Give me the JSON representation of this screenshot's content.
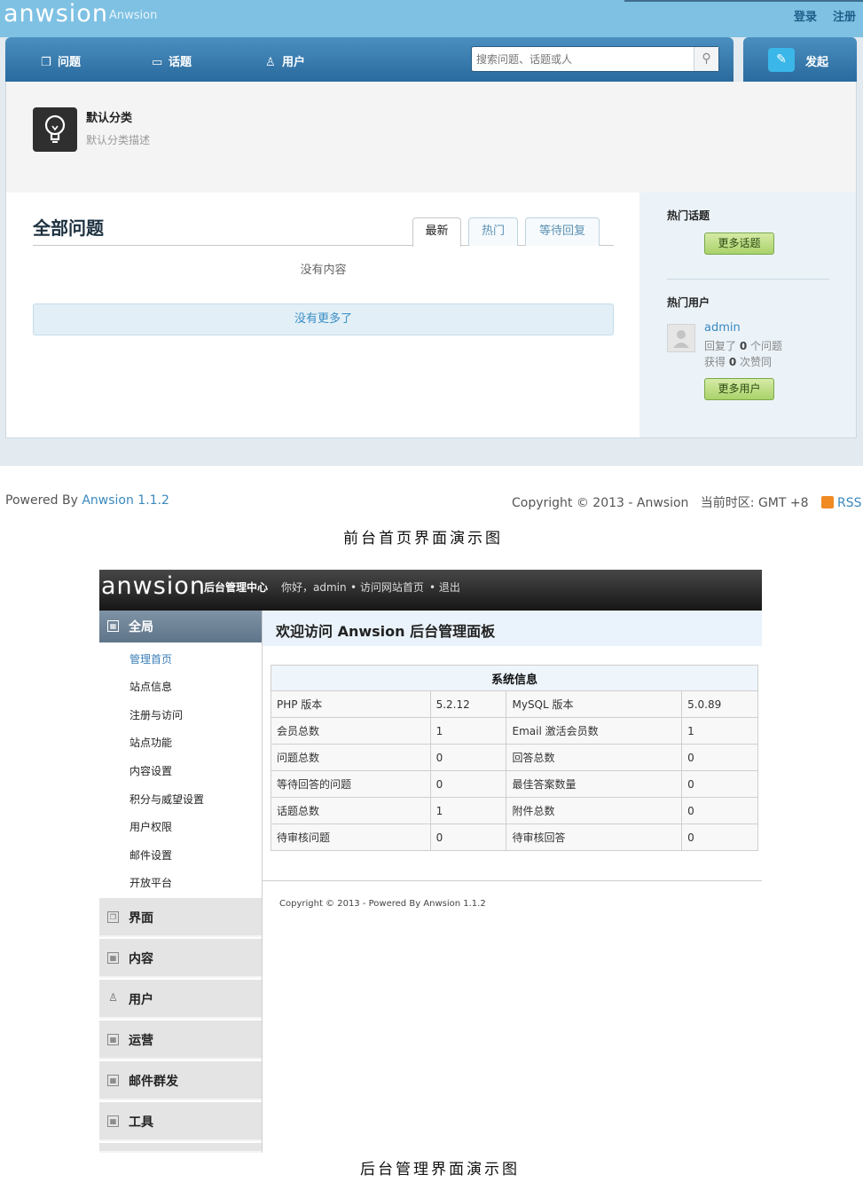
{
  "front": {
    "logo": "anwsion",
    "site_name": "Anwsion",
    "top_links": {
      "login": "登录",
      "register": "注册"
    },
    "nav": [
      {
        "label": "问题",
        "icon": "questions-icon"
      },
      {
        "label": "话题",
        "icon": "topics-icon"
      },
      {
        "label": "用户",
        "icon": "users-icon"
      }
    ],
    "search": {
      "placeholder": "搜索问题、话题或人"
    },
    "publish_label": "发起",
    "category": {
      "name": "默认分类",
      "description": "默认分类描述"
    },
    "main": {
      "title": "全部问题",
      "tabs": [
        "最新",
        "热门",
        "等待回复"
      ],
      "active_tab": "最新",
      "empty_text": "没有内容",
      "no_more": "没有更多了"
    },
    "sidebar": {
      "hot_topics_title": "热门话题",
      "more_topics": "更多话题",
      "hot_users_title": "热门用户",
      "user": {
        "name": "admin",
        "answered_prefix": "回复了",
        "answered_count": "0",
        "answered_suffix": "个问题",
        "agree_prefix": "获得",
        "agree_count": "0",
        "agree_suffix": "次赞同"
      },
      "more_users": "更多用户"
    },
    "footer": {
      "powered_prefix": "Powered By",
      "powered_link": "Anwsion 1.1.2",
      "copyright": "Copyright © 2013 - Anwsion",
      "timezone": "当前时区: GMT +8",
      "rss": "RSS Feed"
    }
  },
  "captions": {
    "front": "前台首页界面演示图",
    "admin": "后台管理界面演示图"
  },
  "admin": {
    "logo": "anwsion",
    "center_title": "后台管理中心",
    "greeting": "你好，admin",
    "visit_site": "• 访问网站首页",
    "logout": "• 退出",
    "menu": {
      "active_group": "全局",
      "sub_items": [
        "管理首页",
        "站点信息",
        "注册与访问",
        "站点功能",
        "内容设置",
        "积分与威望设置",
        "用户权限",
        "邮件设置",
        "开放平台"
      ],
      "current_sub": "管理首页",
      "groups": [
        "界面",
        "内容",
        "用户",
        "运营",
        "邮件群发",
        "工具"
      ]
    },
    "welcome": "欢迎访问 Anwsion 后台管理面板",
    "sysinfo": {
      "title": "系统信息",
      "rows": [
        [
          "PHP 版本",
          "5.2.12",
          "MySQL 版本",
          "5.0.89"
        ],
        [
          "会员总数",
          "1",
          "Email 激活会员数",
          "1"
        ],
        [
          "问题总数",
          "0",
          "回答总数",
          "0"
        ],
        [
          "等待回答的问题",
          "0",
          "最佳答案数量",
          "0"
        ],
        [
          "话题总数",
          "1",
          "附件总数",
          "0"
        ],
        [
          "待审核问题",
          "0",
          "待审核回答",
          "0"
        ]
      ]
    },
    "copyright": "Copyright © 2013 - Powered By Anwsion 1.1.2"
  }
}
